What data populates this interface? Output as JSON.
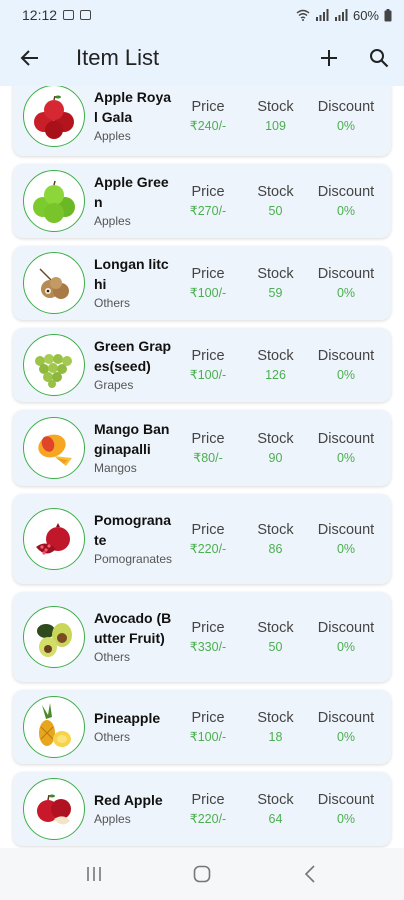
{
  "status": {
    "time": "12:12",
    "battery": "60%"
  },
  "header": {
    "title": "Item List"
  },
  "columns": {
    "price": "Price",
    "stock": "Stock",
    "discount": "Discount"
  },
  "items": [
    {
      "name": "Apple Royal Gala",
      "category": "Apples",
      "price": "₹240/-",
      "stock": "109",
      "discount": "0%",
      "icon": "red-apples-icon"
    },
    {
      "name": "Apple Green",
      "category": "Apples",
      "price": "₹270/-",
      "stock": "50",
      "discount": "0%",
      "icon": "green-apples-icon"
    },
    {
      "name": "Longan litchi",
      "category": "Others",
      "price": "₹100/-",
      "stock": "59",
      "discount": "0%",
      "icon": "longan-icon"
    },
    {
      "name": "Green Grapes(seed)",
      "category": "Grapes",
      "price": "₹100/-",
      "stock": "126",
      "discount": "0%",
      "icon": "grapes-icon"
    },
    {
      "name": "Mango Banginapalli",
      "category": "Mangos",
      "price": "₹80/-",
      "stock": "90",
      "discount": "0%",
      "icon": "mango-icon"
    },
    {
      "name": "Pomogranate",
      "category": "Pomogranates",
      "price": "₹220/-",
      "stock": "86",
      "discount": "0%",
      "icon": "pomegranate-icon"
    },
    {
      "name": "Avocado (Butter Fruit)",
      "category": "Others",
      "price": "₹330/-",
      "stock": "50",
      "discount": "0%",
      "icon": "avocado-icon"
    },
    {
      "name": "Pineapple",
      "category": "Others",
      "price": "₹100/-",
      "stock": "18",
      "discount": "0%",
      "icon": "pineapple-icon"
    },
    {
      "name": "Red Apple",
      "category": "Apples",
      "price": "₹220/-",
      "stock": "64",
      "discount": "0%",
      "icon": "red-apple-icon"
    }
  ]
}
